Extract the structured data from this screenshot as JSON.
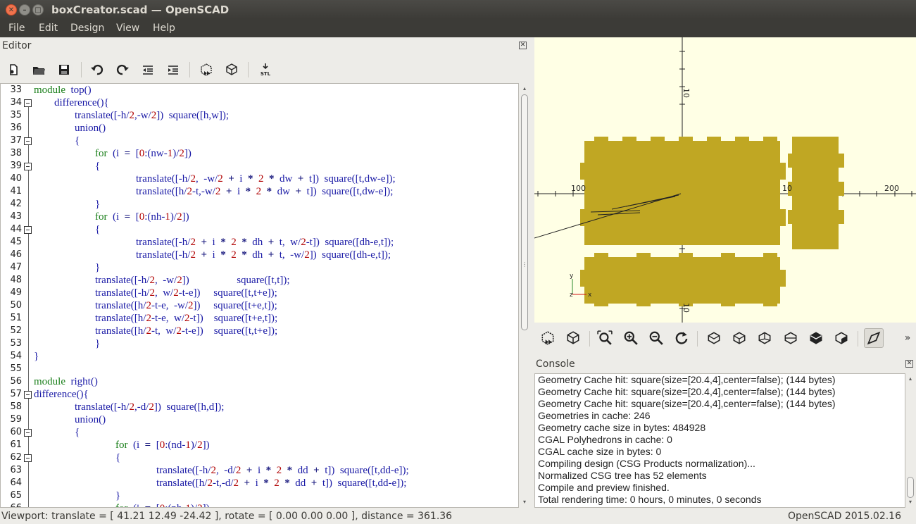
{
  "window": {
    "title": "boxCreator.scad — OpenSCAD"
  },
  "menu": [
    "File",
    "Edit",
    "Design",
    "View",
    "Help"
  ],
  "editor": {
    "title": "Editor",
    "toolbar": [
      "new-file-icon",
      "open-file-icon",
      "save-icon",
      "undo-icon",
      "redo-icon",
      "unindent-icon",
      "indent-icon",
      "preview-icon",
      "render-icon",
      "export-stl-icon"
    ],
    "stl_label": "STL",
    "lines": [
      {
        "n": "33",
        "fold": false,
        "indent": 0,
        "code": "module  top()"
      },
      {
        "n": "34",
        "fold": true,
        "indent": 1,
        "code": "difference(){"
      },
      {
        "n": "35",
        "fold": false,
        "indent": 2,
        "code": "translate([-h/2,-w/2])  square([h,w]);"
      },
      {
        "n": "36",
        "fold": false,
        "indent": 2,
        "code": "union()"
      },
      {
        "n": "37",
        "fold": true,
        "indent": 2,
        "code": "{"
      },
      {
        "n": "38",
        "fold": false,
        "indent": 3,
        "code": "for  (i  =  [0:(nw-1)/2])"
      },
      {
        "n": "39",
        "fold": true,
        "indent": 3,
        "code": "{"
      },
      {
        "n": "40",
        "fold": false,
        "indent": 5,
        "code": "translate([-h/2,  -w/2  +  i  *  2  *  dw  +  t])  square([t,dw-e]);"
      },
      {
        "n": "41",
        "fold": false,
        "indent": 5,
        "code": "translate([h/2-t,-w/2  +  i  *  2  *  dw  +  t])  square([t,dw-e]);"
      },
      {
        "n": "42",
        "fold": false,
        "indent": 3,
        "code": "}"
      },
      {
        "n": "43",
        "fold": false,
        "indent": 3,
        "code": "for  (i  =  [0:(nh-1)/2])"
      },
      {
        "n": "44",
        "fold": true,
        "indent": 3,
        "code": "{"
      },
      {
        "n": "45",
        "fold": false,
        "indent": 5,
        "code": "translate([-h/2  +  i  *  2  *  dh  +  t,  w/2-t])  square([dh-e,t]);"
      },
      {
        "n": "46",
        "fold": false,
        "indent": 5,
        "code": "translate([-h/2  +  i  *  2  *  dh  +  t,  -w/2])  square([dh-e,t]);"
      },
      {
        "n": "47",
        "fold": false,
        "indent": 3,
        "code": "}"
      },
      {
        "n": "48",
        "fold": false,
        "indent": 3,
        "code": "translate([-h/2,  -w/2])                  square([t,t]);"
      },
      {
        "n": "49",
        "fold": false,
        "indent": 3,
        "code": "translate([-h/2,  w/2-t-e])     square([t,t+e]);"
      },
      {
        "n": "50",
        "fold": false,
        "indent": 3,
        "code": "translate([h/2-t-e,  -w/2])     square([t+e,t]);"
      },
      {
        "n": "51",
        "fold": false,
        "indent": 3,
        "code": "translate([h/2-t-e,  w/2-t])    square([t+e,t]);"
      },
      {
        "n": "52",
        "fold": false,
        "indent": 3,
        "code": "translate([h/2-t,  w/2-t-e])    square([t,t+e]);"
      },
      {
        "n": "53",
        "fold": false,
        "indent": 3,
        "code": "}"
      },
      {
        "n": "54",
        "fold": false,
        "indent": 0,
        "code": "}"
      },
      {
        "n": "55",
        "fold": false,
        "indent": 0,
        "code": ""
      },
      {
        "n": "56",
        "fold": false,
        "indent": 0,
        "code": "module  right()"
      },
      {
        "n": "57",
        "fold": true,
        "indent": 0,
        "code": "difference(){"
      },
      {
        "n": "58",
        "fold": false,
        "indent": 2,
        "code": "translate([-h/2,-d/2])  square([h,d]);"
      },
      {
        "n": "59",
        "fold": false,
        "indent": 2,
        "code": "union()"
      },
      {
        "n": "60",
        "fold": true,
        "indent": 2,
        "code": "{"
      },
      {
        "n": "61",
        "fold": false,
        "indent": 4,
        "code": "for  (i  =  [0:(nd-1)/2])"
      },
      {
        "n": "62",
        "fold": true,
        "indent": 4,
        "code": "{"
      },
      {
        "n": "63",
        "fold": false,
        "indent": 6,
        "code": "translate([-h/2,  -d/2  +  i  *  2  *  dd  +  t])  square([t,dd-e]);"
      },
      {
        "n": "64",
        "fold": false,
        "indent": 6,
        "code": "translate([h/2-t,-d/2  +  i  *  2  *  dd  +  t])  square([t,dd-e]);"
      },
      {
        "n": "65",
        "fold": false,
        "indent": 4,
        "code": "}"
      },
      {
        "n": "66",
        "fold": false,
        "indent": 4,
        "code": "for  (i  =  [0:(nh-1)/2])"
      }
    ]
  },
  "viewport": {
    "axis_labels": {
      "x_neg": "100",
      "x_pos": "200",
      "y_mark": "10",
      "x_mid": "10"
    },
    "gizmo": {
      "x": "x",
      "y": "y",
      "z": "z"
    },
    "part_color": "#c0a723",
    "background": "#ffffe5"
  },
  "view_toolbar": [
    "preview-icon",
    "render-icon",
    "view-all-icon",
    "zoom-in-icon",
    "zoom-out-icon",
    "reset-view-icon",
    "view-right-icon",
    "view-top-icon",
    "view-bottom-icon",
    "view-left-icon",
    "view-front-icon",
    "view-back-icon",
    "perspective-icon"
  ],
  "console": {
    "title": "Console",
    "lines": [
      "Geometry Cache hit: square(size=[20.4,4],center=false); (144 bytes)",
      "Geometry Cache hit: square(size=[20.4,4],center=false); (144 bytes)",
      "Geometry Cache hit: square(size=[20.4,4],center=false); (144 bytes)",
      "Geometries in cache: 246",
      "Geometry cache size in bytes: 484928",
      "CGAL Polyhedrons in cache: 0",
      "CGAL cache size in bytes: 0",
      "Compiling design (CSG Products normalization)...",
      "Normalized CSG tree has 52 elements",
      "Compile and preview finished.",
      "Total rendering time: 0 hours, 0 minutes, 0 seconds"
    ]
  },
  "status": {
    "viewport": "Viewport: translate = [ 41.21 12.49 -24.42 ], rotate = [ 0.00 0.00 0.00 ], distance = 361.36",
    "version": "OpenSCAD 2015.02.16"
  }
}
